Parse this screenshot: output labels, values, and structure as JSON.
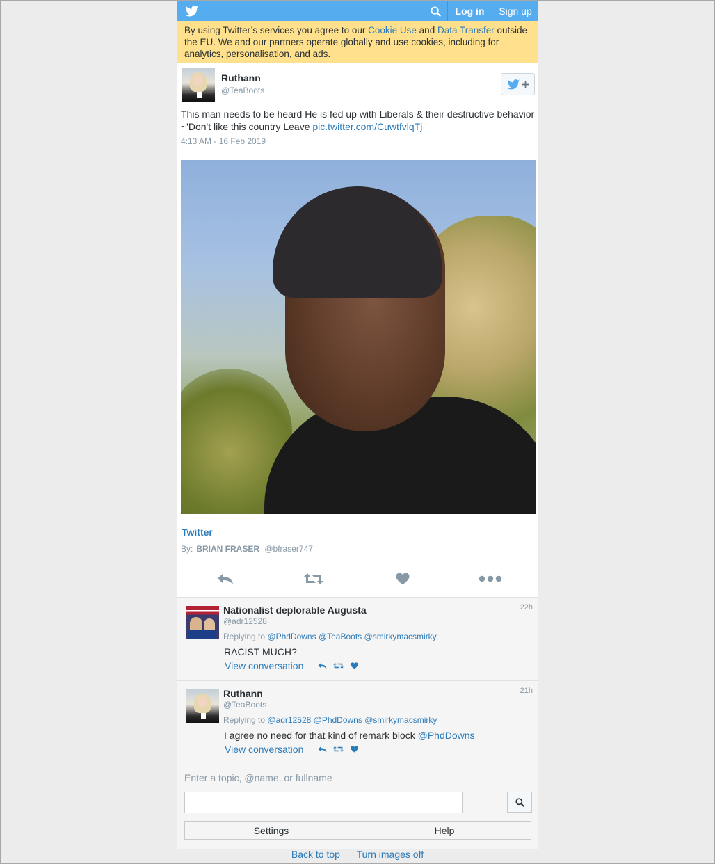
{
  "topbar": {
    "login_label": "Log in",
    "signup_label": "Sign up",
    "brand_color": "#55acee"
  },
  "cookie_banner": {
    "text_1": "By using Twitter’s services you agree to our ",
    "cookie_link": "Cookie Use",
    "text_2": " and ",
    "transfer_link": "Data Transfer",
    "text_3": " outside the EU. We and our partners operate globally and use cookies, including for analytics, personalisation, and ads.",
    "background": "#ffe08c"
  },
  "tweet": {
    "author_name": "Ruthann",
    "author_handle": "@TeaBoots",
    "text": "This man needs to be heard He is fed up with Liberals & their destructive behavior ~'Don't like this country Leave ",
    "link": "pic.twitter.com/CuwtfvlqTj",
    "timestamp": "4:13 AM - 16 Feb 2019",
    "card_title": "Twitter",
    "card_by_label": "By:",
    "card_by_name": "BRIAN FRASER",
    "card_by_handle": "@bfraser747"
  },
  "replies": [
    {
      "name": "Nationalist deplorable Augusta",
      "handle": "@adr12528",
      "time": "22h",
      "replying_label": "Replying to",
      "mentions": [
        "@PhdDowns",
        "@TeaBoots",
        "@smirkymacsmirky"
      ],
      "text": "RACIST MUCH?",
      "text_link": "",
      "view_conversation": "View conversation"
    },
    {
      "name": "Ruthann",
      "handle": "@TeaBoots",
      "time": "21h",
      "replying_label": "Replying to",
      "mentions": [
        "@adr12528",
        "@PhdDowns",
        "@smirkymacsmirky"
      ],
      "text": "I agree no need for that kind of remark block ",
      "text_link": "@PhdDowns",
      "view_conversation": "View conversation"
    }
  ],
  "search": {
    "label": "Enter a topic, @name, or fullname",
    "value": "",
    "settings_label": "Settings",
    "help_label": "Help"
  },
  "footer": {
    "back_to_top": "Back to top",
    "turn_images_off": "Turn images off"
  }
}
